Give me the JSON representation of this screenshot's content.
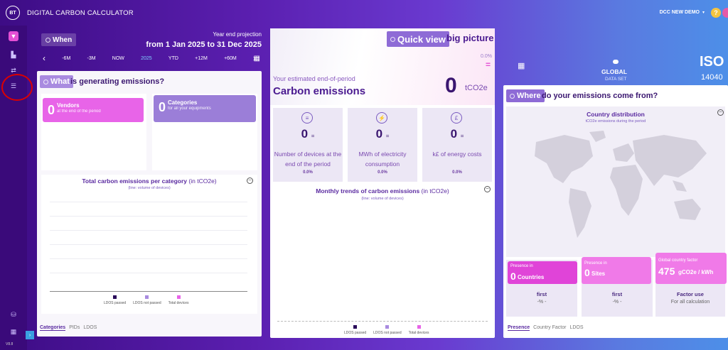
{
  "topbar": {
    "logo": "BT",
    "title": "DIGITAL CARBON CALCULATOR",
    "user": "DCC NEW DEMO",
    "caret": "▾",
    "help": "?"
  },
  "sidebar": {
    "version": "V8.8",
    "expand": "›"
  },
  "when": {
    "tab": "When",
    "subtitle": "Year end projection",
    "range": "from 1 Jan 2025 to 31 Dec 2025",
    "timeline": [
      "-6M",
      "-3M",
      "NOW",
      "2025",
      "YTD",
      "+12M",
      "+60M"
    ],
    "active_index": 3,
    "prev": "‹",
    "next": "›"
  },
  "left": {
    "header_tab": "What",
    "header_rest": "is generating emissions?",
    "vendors": {
      "value": "0",
      "title": "Vendors",
      "sub": "at the end of the period"
    },
    "categories": {
      "value": "0",
      "title": "Categories",
      "sub": "for all your equipments"
    },
    "chart": {
      "title": "Total carbon emissions per category",
      "unit": "(in tCO2e)",
      "sub": "(line: volume of devices)"
    },
    "legend": [
      "LDOS passed",
      "LDOS not passed",
      "Total devices"
    ],
    "tabs": [
      "Categories",
      "PIDs",
      "LDOS"
    ],
    "selected_tab": 0
  },
  "mid": {
    "header_tab": "Quick view",
    "header_rest": "big picture",
    "pct": "0.0%",
    "eq": "=",
    "estimated": "Your estimated end-of-period",
    "carbon": "Carbon emissions",
    "total": "0",
    "unit": "tCO2e",
    "kpis": [
      {
        "icon": "≡",
        "value": "0",
        "eq": "=",
        "label": "Number of devices at the end of the period",
        "pct": "0.0%"
      },
      {
        "icon": "⚡",
        "value": "0",
        "eq": "=",
        "label": "MWh of electricity consumption",
        "pct": "0.0%"
      },
      {
        "icon": "£",
        "value": "0",
        "eq": "=",
        "label": "k£ of energy costs",
        "pct": "0.0%"
      }
    ],
    "chart": {
      "title": "Monthly trends of carbon emissions",
      "unit": "(in tCO2e)",
      "sub": "(line: volume of devices)"
    },
    "legend": [
      "LDOS passed",
      "LDOS not passed",
      "Total devices"
    ]
  },
  "right": {
    "global": "GLOBAL",
    "dataset": "DATA SET",
    "iso": "ISO",
    "iso_num": "14040",
    "header_tab": "Where",
    "header_rest": "do your emissions come from?",
    "map": {
      "title": "Country distribution",
      "sub": "tCO2e emissions during the period"
    },
    "presence_countries": {
      "label": "Presence in",
      "value": "0",
      "unit": "Countries",
      "first": "first",
      "pct": "-% -"
    },
    "presence_sites": {
      "label": "Presence in",
      "value": "0",
      "unit": "Sites",
      "first": "first",
      "pct": "-% -"
    },
    "factor": {
      "label": "Global country factor",
      "value": "475",
      "unit": "gCO2e / kWh",
      "title": "Factor use",
      "sub": "For all calculation"
    },
    "tabs": [
      "Presence",
      "Country Factor",
      "LDOS"
    ],
    "selected_tab": 0
  },
  "colors": {
    "accent": "#e44fd4",
    "purple": "#5a2aa0",
    "lilac": "#8e6bd6"
  }
}
